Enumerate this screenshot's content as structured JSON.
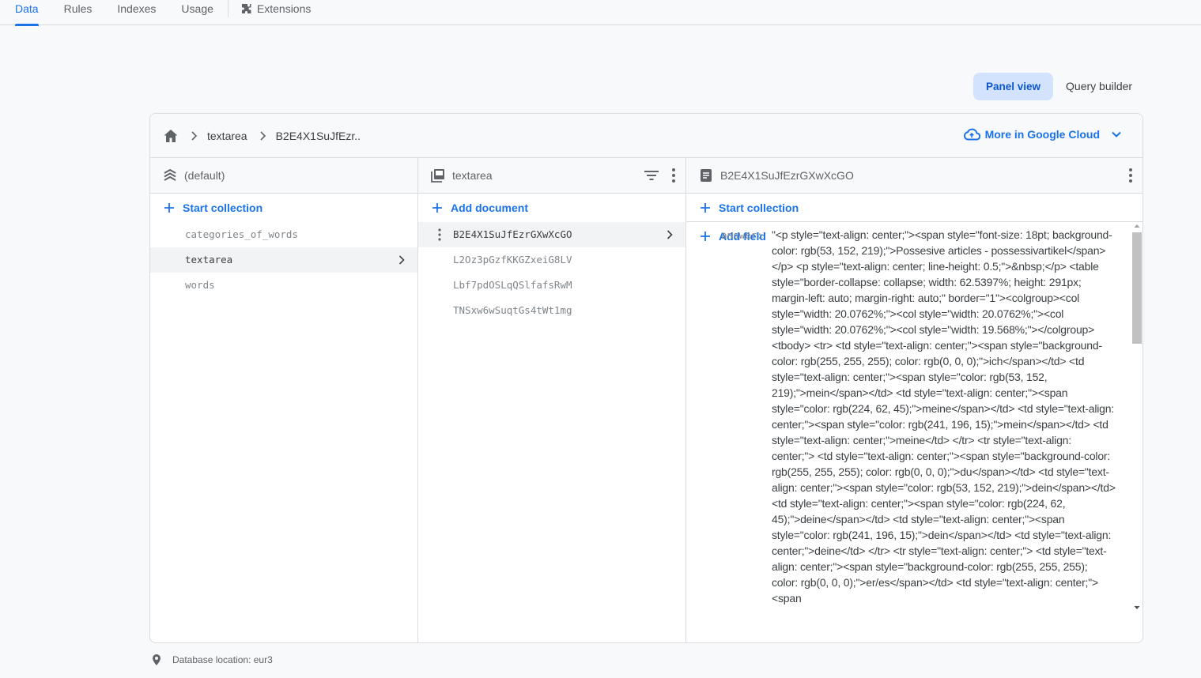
{
  "tabs": [
    {
      "label": "Data",
      "active": true
    },
    {
      "label": "Rules"
    },
    {
      "label": "Indexes"
    },
    {
      "label": "Usage"
    },
    {
      "label": "Extensions",
      "icon": "extension-icon"
    }
  ],
  "view_toggle": {
    "panel_view": "Panel view",
    "query_builder": "Query builder"
  },
  "breadcrumb": {
    "items": [
      "textarea",
      "B2E4X1SuJfEzr.."
    ],
    "home_icon": "home-icon"
  },
  "google_cloud": {
    "label": "More in Google Cloud"
  },
  "columns": {
    "root": {
      "title": "(default)",
      "action": "Start collection",
      "items": [
        "categories_of_words",
        "textarea",
        "words"
      ],
      "selected": "textarea"
    },
    "collection": {
      "title": "textarea",
      "action": "Add document",
      "items": [
        "B2E4X1SuJfEzrGXwXcGO",
        "L2Oz3pGzfKKGZxeiG8LV",
        "Lbf7pdOSLqQSlfafsRwM",
        "TNSxw6wSuqtGs4tWt1mg"
      ],
      "selected": "B2E4X1SuJfEzrGXwXcGO"
    },
    "document": {
      "title": "B2E4X1SuJfEzrGXwXcGO",
      "action_collection": "Start collection",
      "action_field": "Add field",
      "field_key": "answer:",
      "field_value": "\"<p style=\"text-align: center;\"><span style=\"font-size: 18pt; background-color: rgb(53, 152, 219);\">Possesive articles - possessivartikel</span></p> <p style=\"text-align: center; line-height: 0.5;\">&nbsp;</p> <table style=\"border-collapse: collapse; width: 62.5397%; height: 291px; margin-left: auto; margin-right: auto;\" border=\"1\"><colgroup><col style=\"width: 20.0762%;\"><col style=\"width: 20.0762%;\"><col style=\"width: 20.0762%;\"><col style=\"width: 19.568%;\"></colgroup> <tbody> <tr> <td style=\"text-align: center;\"><span style=\"background-color: rgb(255, 255, 255); color: rgb(0, 0, 0);\">ich</span></td> <td style=\"text-align: center;\"><span style=\"color: rgb(53, 152, 219);\">mein</span></td> <td style=\"text-align: center;\"><span style=\"color: rgb(224, 62, 45);\">meine</span></td> <td style=\"text-align: center;\"><span style=\"color: rgb(241, 196, 15);\">mein</span></td> <td style=\"text-align: center;\">meine</td> </tr> <tr style=\"text-align: center;\"> <td style=\"text-align: center;\"><span style=\"background-color: rgb(255, 255, 255); color: rgb(0, 0, 0);\">du</span></td> <td style=\"text-align: center;\"><span style=\"color: rgb(53, 152, 219);\">dein</span></td> <td style=\"text-align: center;\"><span style=\"color: rgb(224, 62, 45);\">deine</span></td> <td style=\"text-align: center;\"><span style=\"color: rgb(241, 196, 15);\">dein</span></td> <td style=\"text-align: center;\">deine</td> </tr> <tr style=\"text-align: center;\"> <td style=\"text-align: center;\"><span style=\"background-color: rgb(255, 255, 255); color: rgb(0, 0, 0);\">er/es</span></td> <td style=\"text-align: center;\"><span"
    }
  },
  "footer": {
    "location": "Database location: eur3"
  },
  "colors": {
    "accent": "#1a73e8",
    "toggle_active_bg": "#d3e3fd"
  }
}
